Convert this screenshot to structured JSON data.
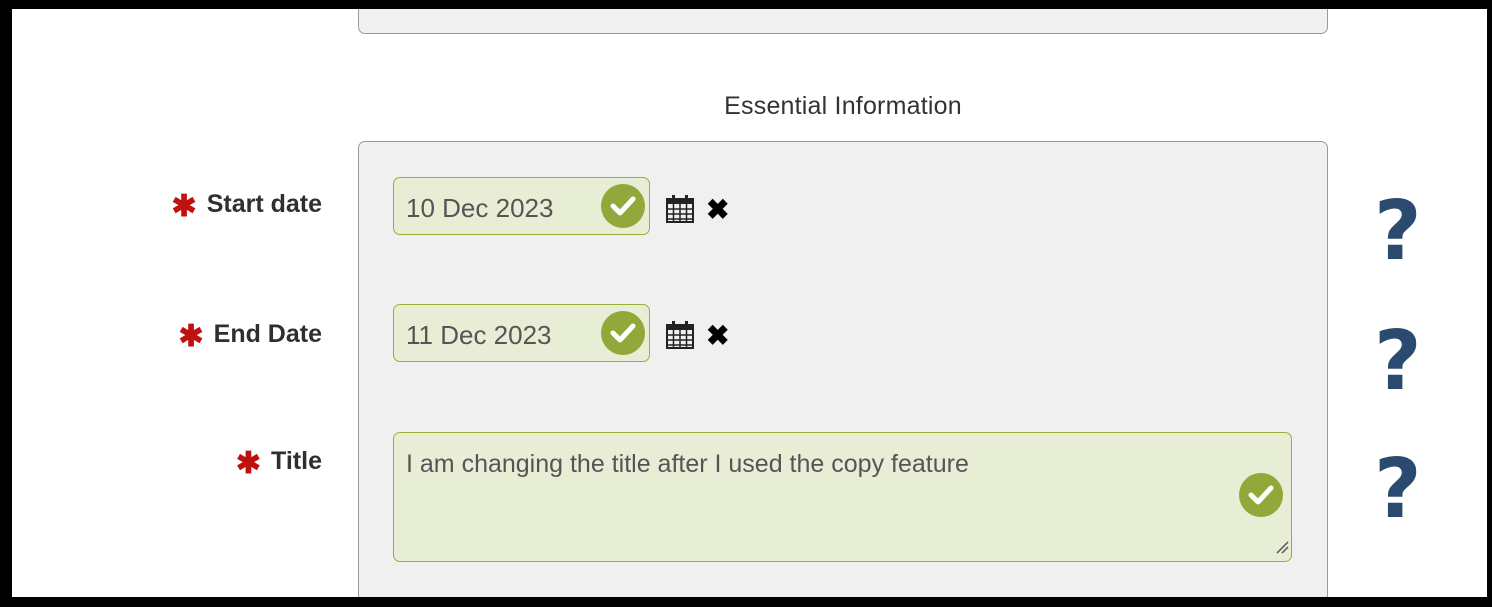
{
  "section": {
    "heading": "Essential Information"
  },
  "fields": {
    "start_date": {
      "required_mark": "✱",
      "label": "Start date",
      "value": "10 Dec 2023",
      "clear": "✖"
    },
    "end_date": {
      "required_mark": "✱",
      "label": "End Date",
      "value": "11 Dec 2023",
      "clear": "✖"
    },
    "title": {
      "required_mark": "✱",
      "label": "Title",
      "value": "I am changing the title after I used the copy feature"
    }
  },
  "help": {
    "glyph": "?"
  },
  "icons": {
    "valid": "check-circle-icon",
    "calendar": "calendar-icon",
    "clear": "close-icon",
    "help": "help-icon"
  },
  "colors": {
    "valid_green": "#93a83a",
    "input_bg": "#e8eed6",
    "required_red": "#c0120c",
    "help_blue": "#2b4a6f"
  }
}
